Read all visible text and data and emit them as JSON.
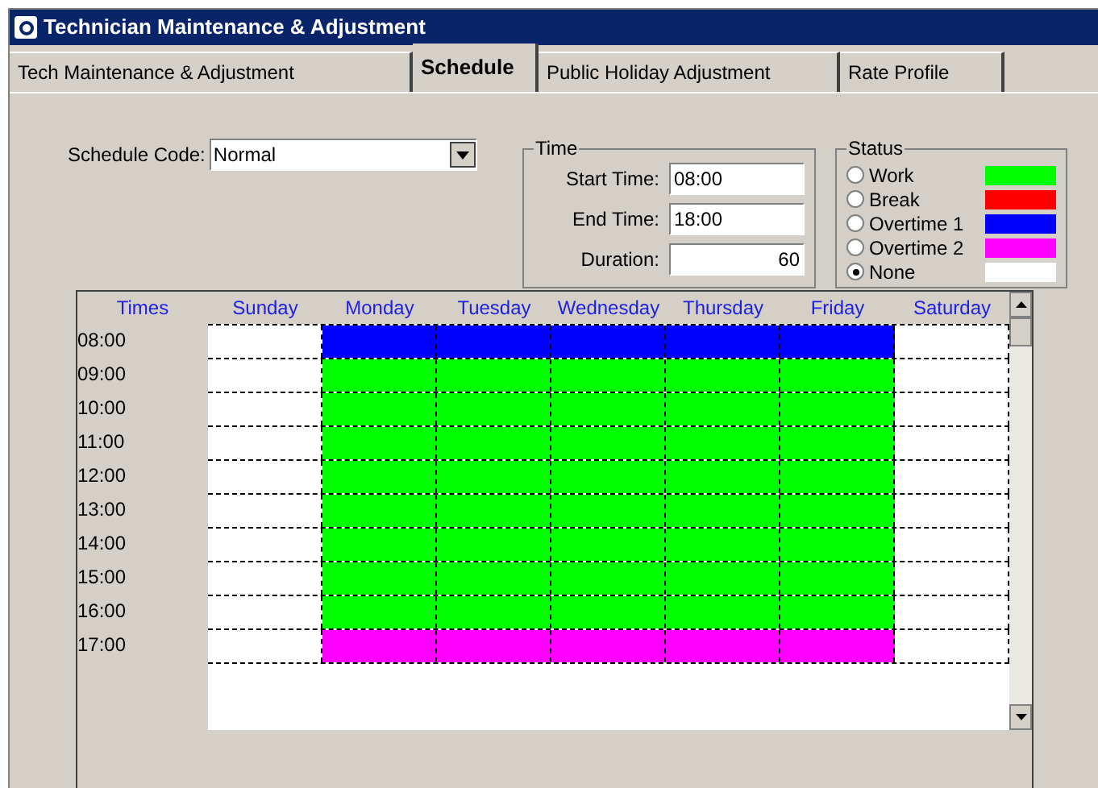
{
  "window": {
    "title": "Technician Maintenance & Adjustment"
  },
  "tabs": [
    {
      "label": "Tech Maintenance & Adjustment",
      "selected": false
    },
    {
      "label": "Schedule",
      "selected": true
    },
    {
      "label": "Public Holiday Adjustment",
      "selected": false
    },
    {
      "label": "Rate Profile",
      "selected": false
    }
  ],
  "schedule_code": {
    "label": "Schedule Code:",
    "value": "Normal"
  },
  "time": {
    "title": "Time",
    "fields": [
      {
        "label": "Start Time:",
        "value": "08:00",
        "kind": "time"
      },
      {
        "label": "End Time:",
        "value": "18:00",
        "kind": "time"
      },
      {
        "label": "Duration:",
        "value": "60",
        "kind": "number"
      }
    ]
  },
  "status": {
    "title": "Status",
    "items": [
      {
        "kind": "work",
        "label": "Work",
        "color": "#00ff00",
        "selected": false
      },
      {
        "kind": "break",
        "label": "Break",
        "color": "#ff0000",
        "selected": false
      },
      {
        "kind": "overtime1",
        "label": "Overtime 1",
        "color": "#0000ff",
        "selected": false
      },
      {
        "kind": "overtime2",
        "label": "Overtime 2",
        "color": "#ff00ff",
        "selected": false
      },
      {
        "kind": "none",
        "label": "None",
        "color": "#ffffff",
        "selected": true
      }
    ]
  },
  "grid": {
    "times_label": "Times",
    "days": [
      "Sunday",
      "Monday",
      "Tuesday",
      "Wednesday",
      "Thursday",
      "Friday",
      "Saturday"
    ],
    "rows": [
      {
        "time": "08:00",
        "cells": [
          {
            "kind": "none"
          },
          {
            "kind": "overtime1"
          },
          {
            "kind": "overtime1"
          },
          {
            "kind": "overtime1"
          },
          {
            "kind": "overtime1"
          },
          {
            "kind": "overtime1"
          },
          {
            "kind": "none"
          }
        ]
      },
      {
        "time": "09:00",
        "cells": [
          {
            "kind": "none"
          },
          {
            "kind": "work"
          },
          {
            "kind": "work"
          },
          {
            "kind": "work"
          },
          {
            "kind": "work"
          },
          {
            "kind": "work"
          },
          {
            "kind": "none"
          }
        ]
      },
      {
        "time": "10:00",
        "cells": [
          {
            "kind": "none"
          },
          {
            "kind": "work"
          },
          {
            "kind": "work"
          },
          {
            "kind": "work"
          },
          {
            "kind": "work"
          },
          {
            "kind": "work"
          },
          {
            "kind": "none"
          }
        ]
      },
      {
        "time": "11:00",
        "cells": [
          {
            "kind": "none"
          },
          {
            "kind": "work"
          },
          {
            "kind": "work"
          },
          {
            "kind": "work"
          },
          {
            "kind": "work"
          },
          {
            "kind": "work"
          },
          {
            "kind": "none"
          }
        ]
      },
      {
        "time": "12:00",
        "cells": [
          {
            "kind": "none"
          },
          {
            "kind": "work"
          },
          {
            "kind": "work"
          },
          {
            "kind": "work"
          },
          {
            "kind": "work"
          },
          {
            "kind": "work"
          },
          {
            "kind": "none"
          }
        ]
      },
      {
        "time": "13:00",
        "cells": [
          {
            "kind": "none"
          },
          {
            "kind": "work"
          },
          {
            "kind": "work"
          },
          {
            "kind": "work"
          },
          {
            "kind": "work"
          },
          {
            "kind": "work"
          },
          {
            "kind": "none"
          }
        ]
      },
      {
        "time": "14:00",
        "cells": [
          {
            "kind": "none"
          },
          {
            "kind": "work"
          },
          {
            "kind": "work"
          },
          {
            "kind": "work"
          },
          {
            "kind": "work"
          },
          {
            "kind": "work"
          },
          {
            "kind": "none"
          }
        ]
      },
      {
        "time": "15:00",
        "cells": [
          {
            "kind": "none"
          },
          {
            "kind": "work"
          },
          {
            "kind": "work"
          },
          {
            "kind": "work"
          },
          {
            "kind": "work"
          },
          {
            "kind": "work"
          },
          {
            "kind": "none"
          }
        ]
      },
      {
        "time": "16:00",
        "cells": [
          {
            "kind": "none"
          },
          {
            "kind": "work"
          },
          {
            "kind": "work"
          },
          {
            "kind": "work"
          },
          {
            "kind": "work"
          },
          {
            "kind": "work"
          },
          {
            "kind": "none"
          }
        ]
      },
      {
        "time": "17:00",
        "cells": [
          {
            "kind": "none"
          },
          {
            "kind": "overtime2"
          },
          {
            "kind": "overtime2"
          },
          {
            "kind": "overtime2"
          },
          {
            "kind": "overtime2"
          },
          {
            "kind": "overtime2"
          },
          {
            "kind": "none"
          }
        ]
      }
    ]
  }
}
